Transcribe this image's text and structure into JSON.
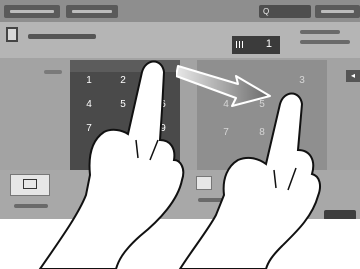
{
  "app": {
    "accent": "#3b3b3b",
    "panel_color": "#a3a3a3"
  },
  "header": {
    "tabs": [
      "",
      ""
    ],
    "search_label": "Q",
    "counter_value": "1"
  },
  "keypad_left": {
    "keys": [
      "1",
      "2",
      "4",
      "5",
      "6",
      "7",
      "9"
    ]
  },
  "keypad_right": {
    "keys": [
      "3",
      "4",
      "5",
      "7",
      "8"
    ]
  },
  "side_button": "◂",
  "icons": [
    "document-icon",
    "grid-icon",
    "book-icon",
    "swipe-arrow-icon"
  ]
}
